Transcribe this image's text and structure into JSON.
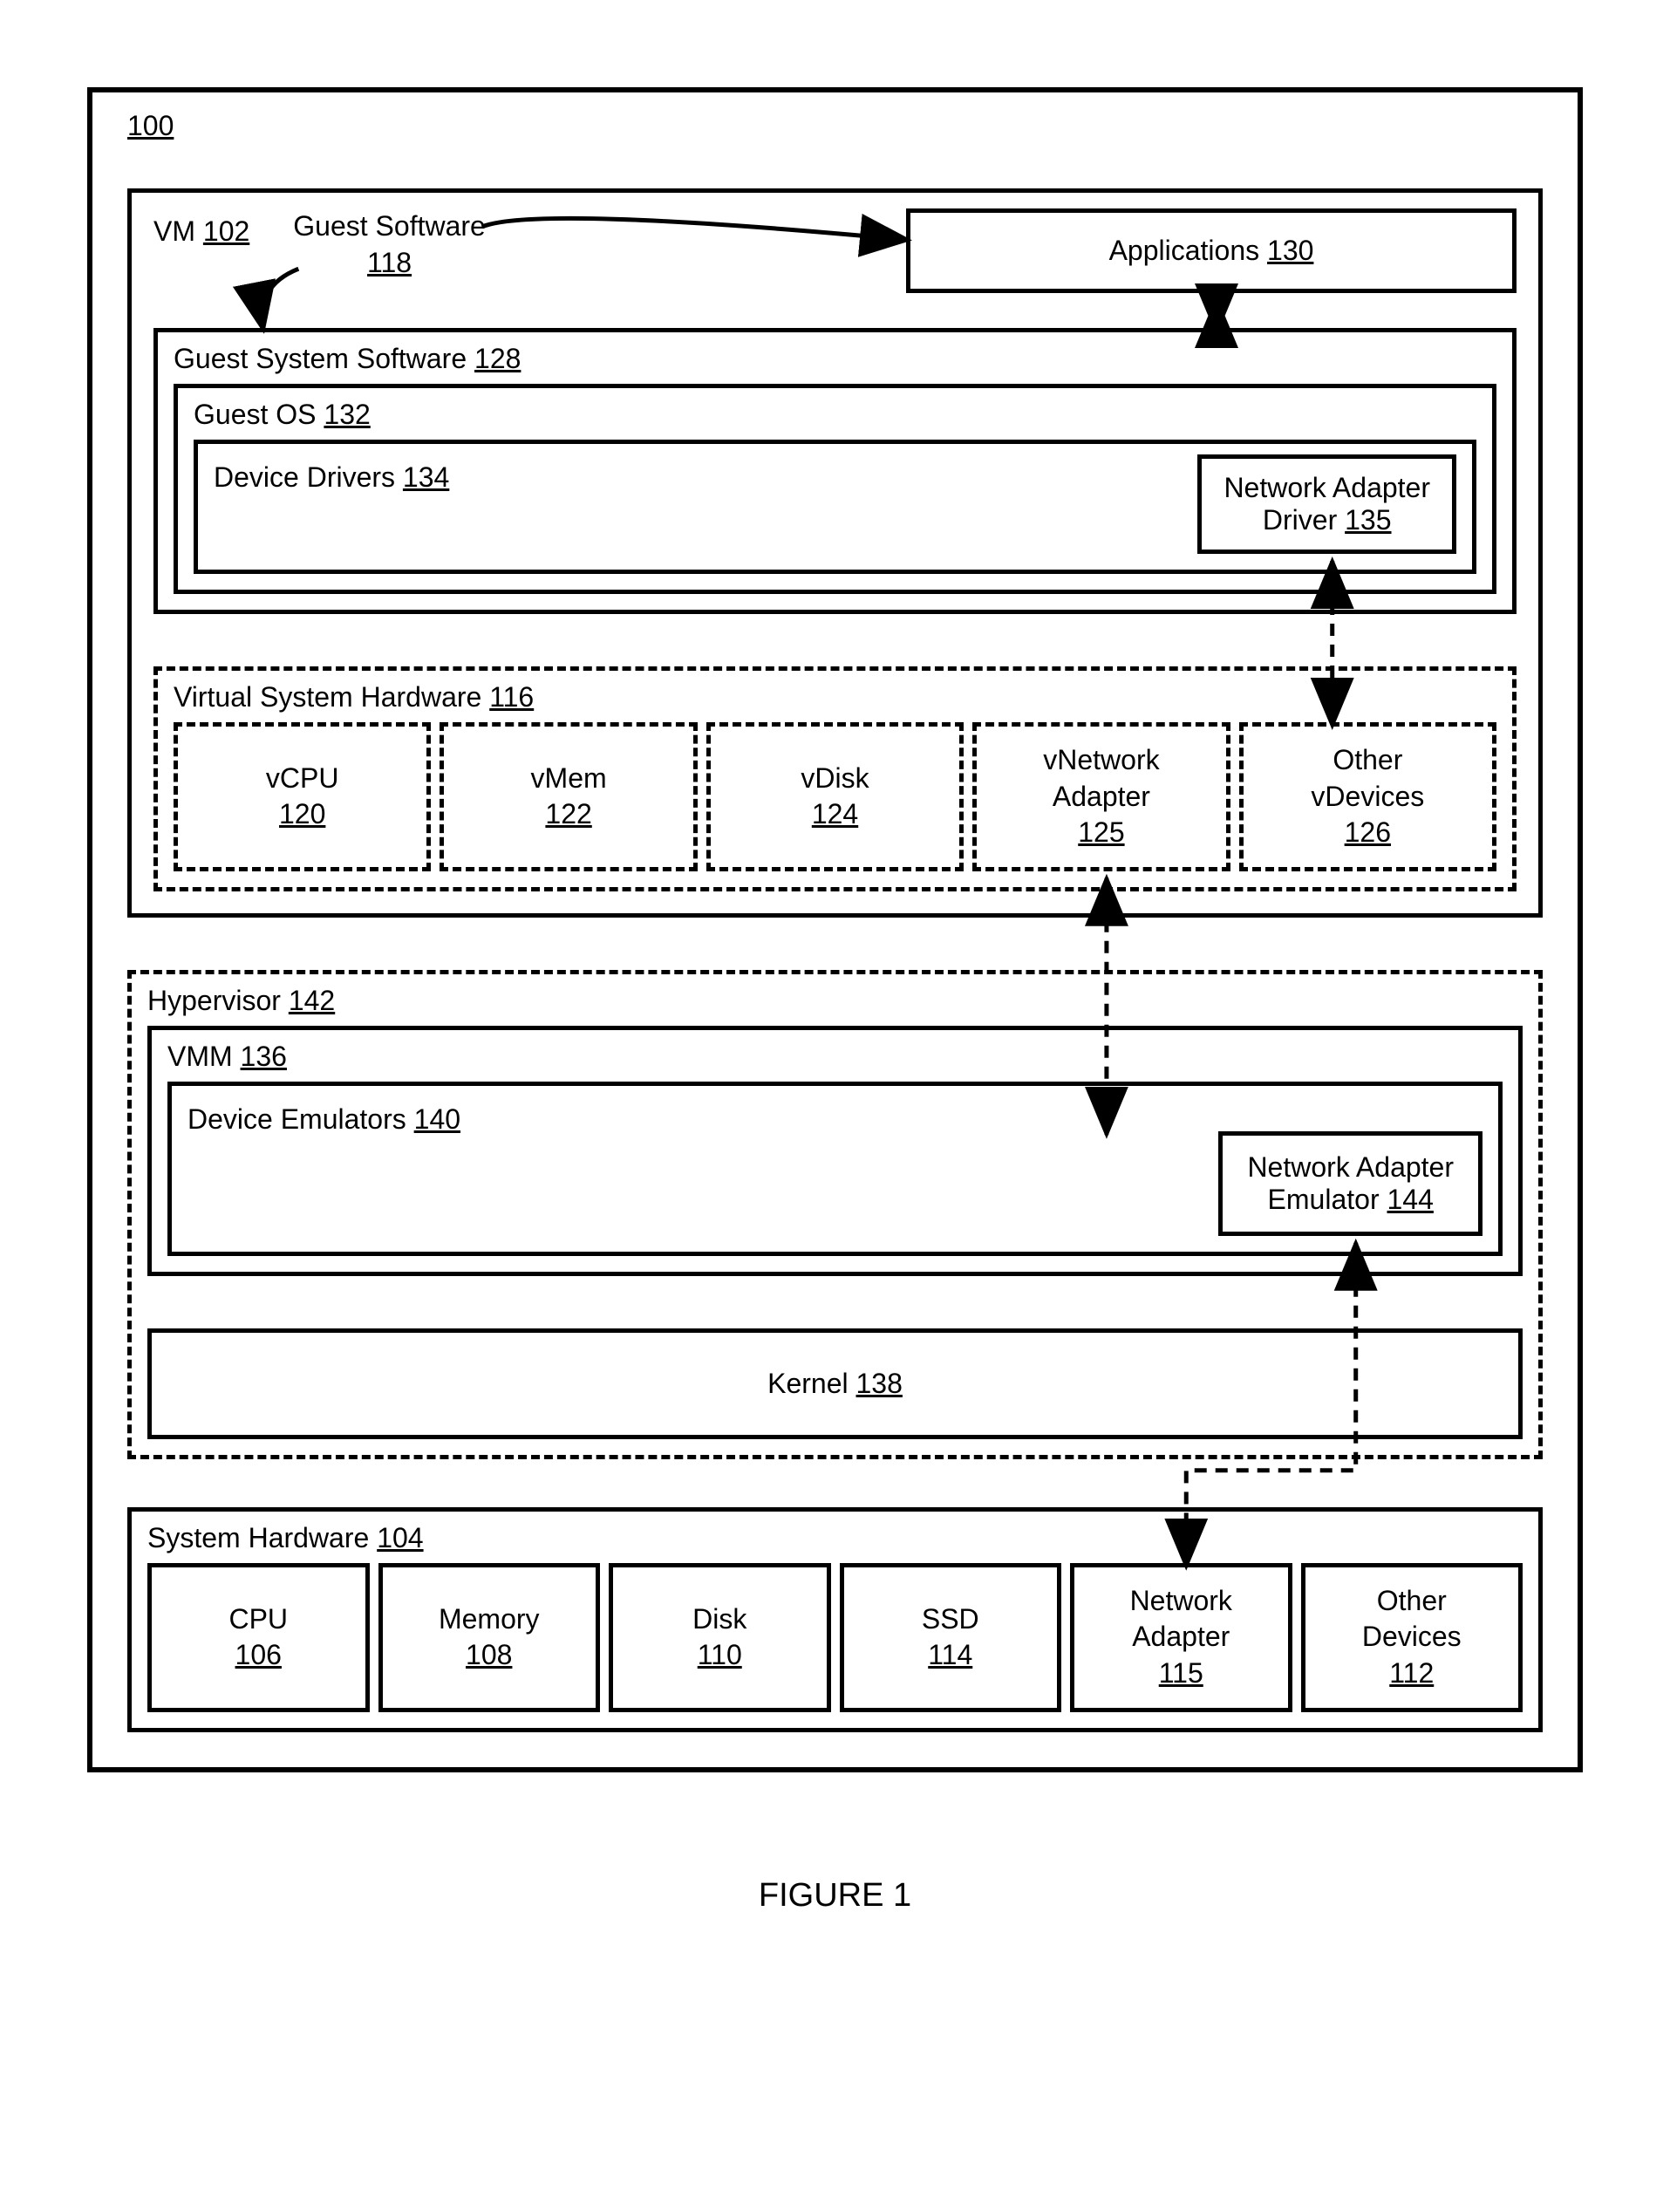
{
  "figure_caption": "FIGURE 1",
  "system": {
    "label": "100",
    "vm": {
      "label": "VM",
      "num": "102",
      "guest_software": {
        "label": "Guest Software",
        "num": "118"
      },
      "applications": {
        "label": "Applications",
        "num": "130"
      },
      "guest_system_software": {
        "label": "Guest System Software",
        "num": "128",
        "guest_os": {
          "label": "Guest OS",
          "num": "132",
          "device_drivers": {
            "label": "Device Drivers",
            "num": "134",
            "network_adapter_driver": {
              "label": "Network Adapter Driver",
              "num": "135"
            }
          }
        }
      },
      "virtual_system_hardware": {
        "label": "Virtual System Hardware",
        "num": "116",
        "devices": [
          {
            "label": "vCPU",
            "num": "120"
          },
          {
            "label": "vMem",
            "num": "122"
          },
          {
            "label": "vDisk",
            "num": "124"
          },
          {
            "label": "vNetwork Adapter",
            "num": "125"
          },
          {
            "label": "Other vDevices",
            "num": "126"
          }
        ]
      }
    },
    "hypervisor": {
      "label": "Hypervisor",
      "num": "142",
      "vmm": {
        "label": "VMM",
        "num": "136",
        "device_emulators": {
          "label": "Device Emulators",
          "num": "140",
          "network_adapter_emulator": {
            "label": "Network Adapter Emulator",
            "num": "144"
          }
        }
      },
      "kernel": {
        "label": "Kernel",
        "num": "138"
      }
    },
    "system_hardware": {
      "label": "System Hardware",
      "num": "104",
      "devices": [
        {
          "label": "CPU",
          "num": "106"
        },
        {
          "label": "Memory",
          "num": "108"
        },
        {
          "label": "Disk",
          "num": "110"
        },
        {
          "label": "SSD",
          "num": "114"
        },
        {
          "label": "Network Adapter",
          "num": "115"
        },
        {
          "label": "Other Devices",
          "num": "112"
        }
      ]
    }
  }
}
